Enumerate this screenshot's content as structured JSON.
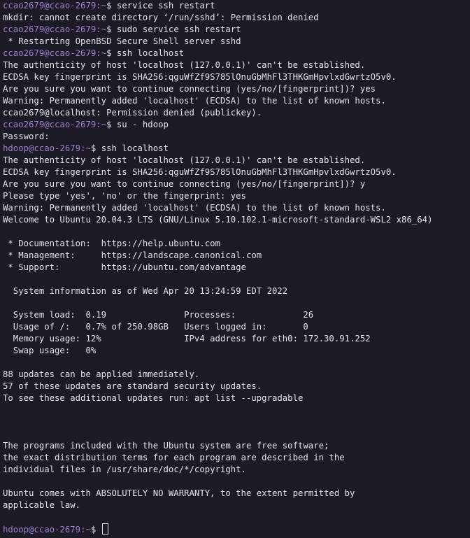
{
  "terminal": {
    "background": "#1c1a24",
    "text_color": "#e4e2ea",
    "prompt_color": "#a07fd0",
    "lines": [
      {
        "type": "prompt",
        "user": "ccao2679@ccao-2679",
        "path": ":~",
        "symbol": "$ ",
        "command": "service ssh restart"
      },
      {
        "type": "output",
        "text": "mkdir: cannot create directory ‘/run/sshd’: Permission denied"
      },
      {
        "type": "prompt",
        "user": "ccao2679@ccao-2679",
        "path": ":~",
        "symbol": "$ ",
        "command": "sudo service ssh restart"
      },
      {
        "type": "output",
        "text": " * Restarting OpenBSD Secure Shell server sshd"
      },
      {
        "type": "prompt",
        "user": "ccao2679@ccao-2679",
        "path": ":~",
        "symbol": "$ ",
        "command": "ssh localhost"
      },
      {
        "type": "output",
        "text": "The authenticity of host 'localhost (127.0.0.1)' can't be established."
      },
      {
        "type": "output",
        "text": "ECDSA key fingerprint is SHA256:qguWfZf9S785lOnuGbMhFl3THKGmHpvlxdGwrtzO5v0."
      },
      {
        "type": "output",
        "text": "Are you sure you want to continue connecting (yes/no/[fingerprint])? yes"
      },
      {
        "type": "output",
        "text": "Warning: Permanently added 'localhost' (ECDSA) to the list of known hosts."
      },
      {
        "type": "output",
        "text": "ccao2679@localhost: Permission denied (publickey)."
      },
      {
        "type": "prompt",
        "user": "ccao2679@ccao-2679",
        "path": ":~",
        "symbol": "$ ",
        "command": "su - hdoop"
      },
      {
        "type": "output",
        "text": "Password:"
      },
      {
        "type": "prompt",
        "user": "hdoop@ccao-2679",
        "path": ":~",
        "symbol": "$ ",
        "command": "ssh localhost"
      },
      {
        "type": "output",
        "text": "The authenticity of host 'localhost (127.0.0.1)' can't be established."
      },
      {
        "type": "output",
        "text": "ECDSA key fingerprint is SHA256:qguWfZf9S785lOnuGbMhFl3THKGmHpvlxdGwrtzO5v0."
      },
      {
        "type": "output",
        "text": "Are you sure you want to continue connecting (yes/no/[fingerprint])? y"
      },
      {
        "type": "output",
        "text": "Please type 'yes', 'no' or the fingerprint: yes"
      },
      {
        "type": "output",
        "text": "Warning: Permanently added 'localhost' (ECDSA) to the list of known hosts."
      },
      {
        "type": "output",
        "text": "Welcome to Ubuntu 20.04.3 LTS (GNU/Linux 5.10.102.1-microsoft-standard-WSL2 x86_64)"
      },
      {
        "type": "output",
        "text": ""
      },
      {
        "type": "output",
        "text": " * Documentation:  https://help.ubuntu.com"
      },
      {
        "type": "output",
        "text": " * Management:     https://landscape.canonical.com"
      },
      {
        "type": "output",
        "text": " * Support:        https://ubuntu.com/advantage"
      },
      {
        "type": "output",
        "text": ""
      },
      {
        "type": "output",
        "text": "  System information as of Wed Apr 20 13:24:59 EDT 2022"
      },
      {
        "type": "output",
        "text": ""
      },
      {
        "type": "output",
        "text": "  System load:  0.19               Processes:             26"
      },
      {
        "type": "output",
        "text": "  Usage of /:   0.7% of 250.98GB   Users logged in:       0"
      },
      {
        "type": "output",
        "text": "  Memory usage: 12%                IPv4 address for eth0: 172.30.91.252"
      },
      {
        "type": "output",
        "text": "  Swap usage:   0%"
      },
      {
        "type": "output",
        "text": ""
      },
      {
        "type": "output",
        "text": "88 updates can be applied immediately."
      },
      {
        "type": "output",
        "text": "57 of these updates are standard security updates."
      },
      {
        "type": "output",
        "text": "To see these additional updates run: apt list --upgradable"
      },
      {
        "type": "output",
        "text": ""
      },
      {
        "type": "output",
        "text": ""
      },
      {
        "type": "output",
        "text": ""
      },
      {
        "type": "output",
        "text": "The programs included with the Ubuntu system are free software;"
      },
      {
        "type": "output",
        "text": "the exact distribution terms for each program are described in the"
      },
      {
        "type": "output",
        "text": "individual files in /usr/share/doc/*/copyright."
      },
      {
        "type": "output",
        "text": ""
      },
      {
        "type": "output",
        "text": "Ubuntu comes with ABSOLUTELY NO WARRANTY, to the extent permitted by"
      },
      {
        "type": "output",
        "text": "applicable law."
      },
      {
        "type": "output",
        "text": ""
      },
      {
        "type": "active-prompt",
        "user": "hdoop@ccao-2679",
        "path": ":~",
        "symbol": "$ ",
        "command": ""
      }
    ]
  }
}
